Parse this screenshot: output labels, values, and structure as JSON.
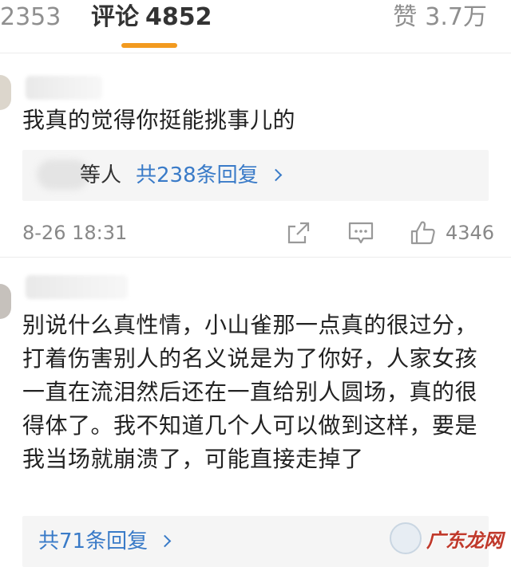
{
  "tabs": {
    "left_count": "2353",
    "comments_label": "评论",
    "comments_count": "4852",
    "likes_label": "赞",
    "likes_count": "3.7万"
  },
  "comments": [
    {
      "text": "我真的觉得你挺能挑事儿的",
      "reply_suffix": "等人",
      "reply_link": "共238条回复",
      "time": "8-26 18:31",
      "like_count": "4346"
    },
    {
      "text": "别说什么真性情，小山雀那一点真的很过分，打着伤害别人的名义说是为了你好，人家女孩一直在流泪然后还在一直给别人圆场，真的很得体了。我不知道几个人可以做到这样，要是我当场就崩溃了，可能直接走掉了",
      "reply_link": "共71条回复"
    }
  ],
  "watermark": {
    "text": "广东龙网"
  },
  "icons": [
    "share-icon",
    "comment-icon",
    "like-icon",
    "chevron-right-icon"
  ],
  "colors": {
    "accent": "#f29a1f",
    "link": "#3a7bc8"
  }
}
